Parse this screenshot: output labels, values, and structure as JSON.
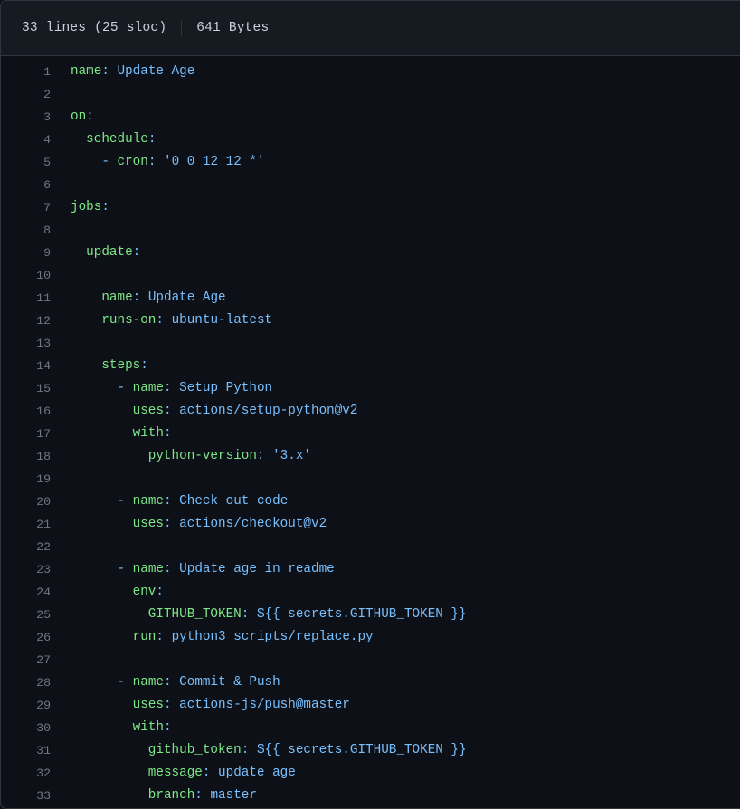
{
  "file_header": {
    "lines_info": "33 lines (25 sloc)",
    "size_info": "641 Bytes",
    "divider": "|"
  },
  "colors": {
    "background": "#0d1117",
    "header_background": "#161b22",
    "border": "#30363d",
    "line_number": "#6e7681",
    "key_green": "#7ee787",
    "value_blue": "#79c0ff",
    "text_default": "#c9d1d9"
  },
  "code": {
    "language": "yaml",
    "total_lines": 33,
    "sloc": 25,
    "bytes": 641,
    "lines": [
      {
        "n": "1",
        "indent": "",
        "tokens": [
          {
            "t": "key",
            "v": "name"
          },
          {
            "t": "punc",
            "v": ":"
          },
          {
            "t": "val",
            "v": " Update Age"
          }
        ]
      },
      {
        "n": "2",
        "indent": "",
        "tokens": []
      },
      {
        "n": "3",
        "indent": "",
        "tokens": [
          {
            "t": "key",
            "v": "on"
          },
          {
            "t": "punc",
            "v": ":"
          }
        ]
      },
      {
        "n": "4",
        "indent": "  ",
        "tokens": [
          {
            "t": "key",
            "v": "schedule"
          },
          {
            "t": "punc",
            "v": ":"
          }
        ]
      },
      {
        "n": "5",
        "indent": "    ",
        "tokens": [
          {
            "t": "dash",
            "v": "- "
          },
          {
            "t": "key",
            "v": "cron"
          },
          {
            "t": "punc",
            "v": ":"
          },
          {
            "t": "val",
            "v": " '0 0 12 12 *'"
          }
        ]
      },
      {
        "n": "6",
        "indent": "",
        "tokens": []
      },
      {
        "n": "7",
        "indent": "",
        "tokens": [
          {
            "t": "key",
            "v": "jobs"
          },
          {
            "t": "punc",
            "v": ":"
          }
        ]
      },
      {
        "n": "8",
        "indent": "",
        "tokens": []
      },
      {
        "n": "9",
        "indent": "  ",
        "tokens": [
          {
            "t": "key",
            "v": "update"
          },
          {
            "t": "punc",
            "v": ":"
          }
        ]
      },
      {
        "n": "10",
        "indent": "",
        "tokens": []
      },
      {
        "n": "11",
        "indent": "    ",
        "tokens": [
          {
            "t": "key",
            "v": "name"
          },
          {
            "t": "punc",
            "v": ":"
          },
          {
            "t": "val",
            "v": " Update Age"
          }
        ]
      },
      {
        "n": "12",
        "indent": "    ",
        "tokens": [
          {
            "t": "key",
            "v": "runs-on"
          },
          {
            "t": "punc",
            "v": ":"
          },
          {
            "t": "val",
            "v": " ubuntu-latest"
          }
        ]
      },
      {
        "n": "13",
        "indent": "",
        "tokens": []
      },
      {
        "n": "14",
        "indent": "    ",
        "tokens": [
          {
            "t": "key",
            "v": "steps"
          },
          {
            "t": "punc",
            "v": ":"
          }
        ]
      },
      {
        "n": "15",
        "indent": "      ",
        "tokens": [
          {
            "t": "dash",
            "v": "- "
          },
          {
            "t": "key",
            "v": "name"
          },
          {
            "t": "punc",
            "v": ":"
          },
          {
            "t": "val",
            "v": " Setup Python"
          }
        ]
      },
      {
        "n": "16",
        "indent": "        ",
        "tokens": [
          {
            "t": "key",
            "v": "uses"
          },
          {
            "t": "punc",
            "v": ":"
          },
          {
            "t": "val",
            "v": " actions/setup-python@v2"
          }
        ]
      },
      {
        "n": "17",
        "indent": "        ",
        "tokens": [
          {
            "t": "key",
            "v": "with"
          },
          {
            "t": "punc",
            "v": ":"
          }
        ]
      },
      {
        "n": "18",
        "indent": "          ",
        "tokens": [
          {
            "t": "key",
            "v": "python-version"
          },
          {
            "t": "punc",
            "v": ":"
          },
          {
            "t": "val",
            "v": " '3.x'"
          }
        ]
      },
      {
        "n": "19",
        "indent": "",
        "tokens": []
      },
      {
        "n": "20",
        "indent": "      ",
        "tokens": [
          {
            "t": "dash",
            "v": "- "
          },
          {
            "t": "key",
            "v": "name"
          },
          {
            "t": "punc",
            "v": ":"
          },
          {
            "t": "val",
            "v": " Check out code"
          }
        ]
      },
      {
        "n": "21",
        "indent": "        ",
        "tokens": [
          {
            "t": "key",
            "v": "uses"
          },
          {
            "t": "punc",
            "v": ":"
          },
          {
            "t": "val",
            "v": " actions/checkout@v2"
          }
        ]
      },
      {
        "n": "22",
        "indent": "",
        "tokens": []
      },
      {
        "n": "23",
        "indent": "      ",
        "tokens": [
          {
            "t": "dash",
            "v": "- "
          },
          {
            "t": "key",
            "v": "name"
          },
          {
            "t": "punc",
            "v": ":"
          },
          {
            "t": "val",
            "v": " Update age in readme"
          }
        ]
      },
      {
        "n": "24",
        "indent": "        ",
        "tokens": [
          {
            "t": "key",
            "v": "env"
          },
          {
            "t": "punc",
            "v": ":"
          }
        ]
      },
      {
        "n": "25",
        "indent": "          ",
        "tokens": [
          {
            "t": "key",
            "v": "GITHUB_TOKEN"
          },
          {
            "t": "punc",
            "v": ":"
          },
          {
            "t": "val",
            "v": " ${{ secrets.GITHUB_TOKEN }}"
          }
        ]
      },
      {
        "n": "26",
        "indent": "        ",
        "tokens": [
          {
            "t": "key",
            "v": "run"
          },
          {
            "t": "punc",
            "v": ":"
          },
          {
            "t": "val",
            "v": " python3 scripts/replace.py"
          }
        ]
      },
      {
        "n": "27",
        "indent": "",
        "tokens": []
      },
      {
        "n": "28",
        "indent": "      ",
        "tokens": [
          {
            "t": "dash",
            "v": "- "
          },
          {
            "t": "key",
            "v": "name"
          },
          {
            "t": "punc",
            "v": ":"
          },
          {
            "t": "val",
            "v": " Commit & Push"
          }
        ]
      },
      {
        "n": "29",
        "indent": "        ",
        "tokens": [
          {
            "t": "key",
            "v": "uses"
          },
          {
            "t": "punc",
            "v": ":"
          },
          {
            "t": "val",
            "v": " actions-js/push@master"
          }
        ]
      },
      {
        "n": "30",
        "indent": "        ",
        "tokens": [
          {
            "t": "key",
            "v": "with"
          },
          {
            "t": "punc",
            "v": ":"
          }
        ]
      },
      {
        "n": "31",
        "indent": "          ",
        "tokens": [
          {
            "t": "key",
            "v": "github_token"
          },
          {
            "t": "punc",
            "v": ":"
          },
          {
            "t": "val",
            "v": " ${{ secrets.GITHUB_TOKEN }}"
          }
        ]
      },
      {
        "n": "32",
        "indent": "          ",
        "tokens": [
          {
            "t": "key",
            "v": "message"
          },
          {
            "t": "punc",
            "v": ":"
          },
          {
            "t": "val",
            "v": " update age"
          }
        ]
      },
      {
        "n": "33",
        "indent": "          ",
        "tokens": [
          {
            "t": "key",
            "v": "branch"
          },
          {
            "t": "punc",
            "v": ":"
          },
          {
            "t": "val",
            "v": " master"
          }
        ]
      }
    ]
  }
}
